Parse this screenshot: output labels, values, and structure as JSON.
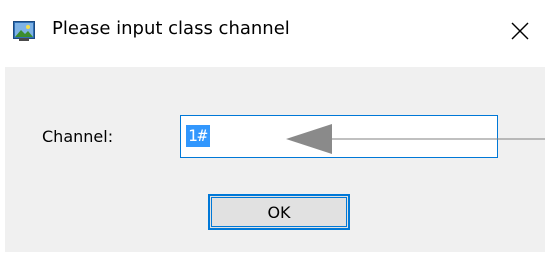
{
  "window": {
    "title": "Please input class channel",
    "icon": "app-icon",
    "close_icon": "close-icon"
  },
  "form": {
    "channel_label": "Channel:",
    "channel_value": "1#",
    "ok_label": "OK"
  },
  "colors": {
    "accent": "#0078d7",
    "selection": "#3297fd",
    "client_bg": "#f0f0f0",
    "button_bg": "#e1e1e1",
    "annotation_arrow": "#808080"
  }
}
